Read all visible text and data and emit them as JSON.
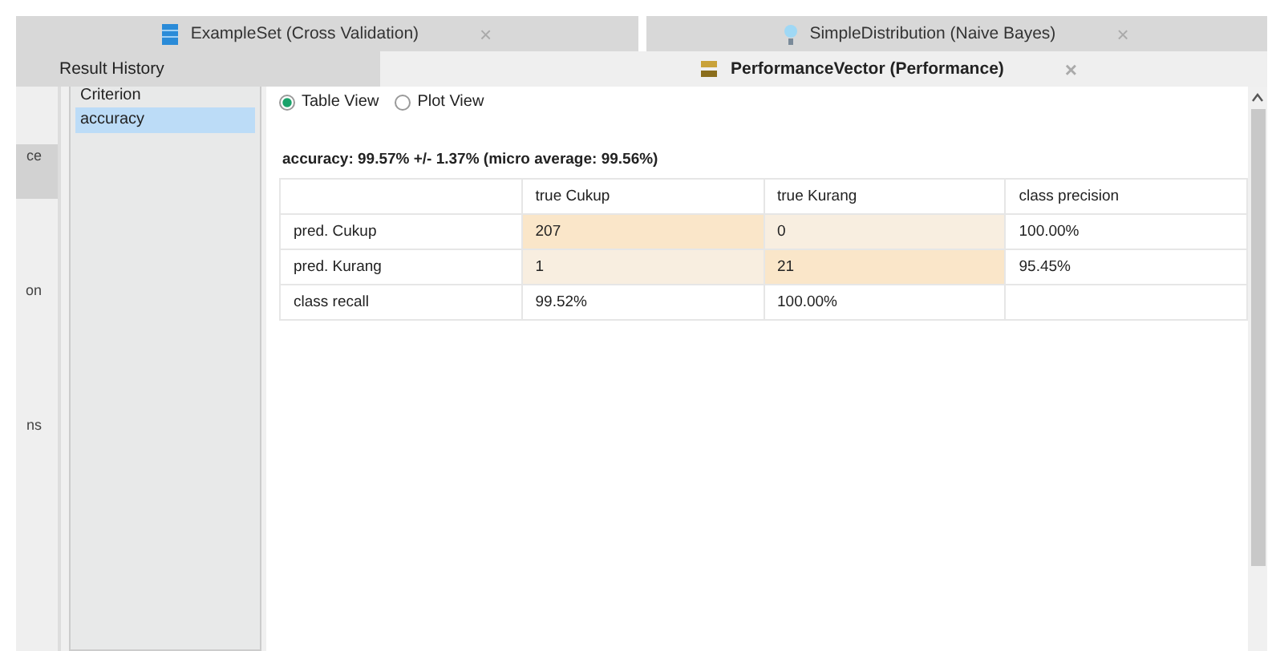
{
  "top_tabs": [
    {
      "label": "ExampleSet (Cross Validation)",
      "close": "×",
      "selected": false
    },
    {
      "label": "SimpleDistribution (Naive Bayes)",
      "close": "×",
      "selected": false
    }
  ],
  "sub_tabs": [
    {
      "label": "Result History",
      "selected": false
    },
    {
      "label": "PerformanceVector (Performance)",
      "close": "×",
      "selected": true
    }
  ],
  "side_items": [
    {
      "label": "ce",
      "selected": true
    },
    {
      "label": "on",
      "selected": false
    },
    {
      "label": "ns",
      "selected": false
    }
  ],
  "criterion": {
    "title": "Criterion",
    "items": [
      {
        "label": "accuracy",
        "selected": true
      }
    ]
  },
  "views": [
    {
      "label": "Table View",
      "selected": true
    },
    {
      "label": "Plot View",
      "selected": false
    }
  ],
  "summary": "accuracy: 99.57% +/- 1.37% (micro average: 99.56%)",
  "table": {
    "columns": [
      "",
      "true Cukup",
      "true Kurang",
      "class precision"
    ],
    "rows": [
      {
        "cells": [
          {
            "text": "pred. Cukup",
            "kind": "plain"
          },
          {
            "text": "207",
            "kind": "strong"
          },
          {
            "text": "0",
            "kind": "weak"
          },
          {
            "text": "100.00%",
            "kind": "plain"
          }
        ]
      },
      {
        "cells": [
          {
            "text": "pred. Kurang",
            "kind": "plain"
          },
          {
            "text": "1",
            "kind": "weak"
          },
          {
            "text": "21",
            "kind": "strong"
          },
          {
            "text": "95.45%",
            "kind": "plain"
          }
        ]
      },
      {
        "cells": [
          {
            "text": "class recall",
            "kind": "plain"
          },
          {
            "text": "99.52%",
            "kind": "plain"
          },
          {
            "text": "100.00%",
            "kind": "plain"
          },
          {
            "text": "",
            "kind": "plain"
          }
        ]
      }
    ]
  }
}
